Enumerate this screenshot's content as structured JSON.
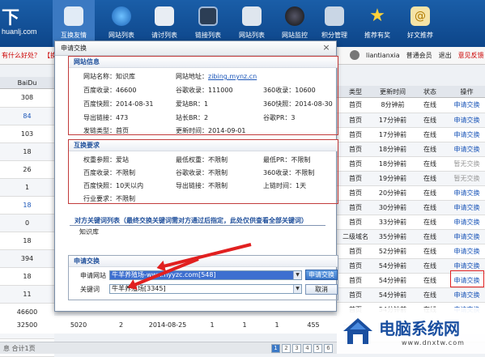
{
  "top": {
    "logo": "下",
    "logo_sub": "huanlj.com",
    "nav": [
      "互换友情",
      "网站列表",
      "请讨列表",
      "链接列表",
      "网站列表",
      "网站监控",
      "积分管理",
      "推荐有奖",
      "好文推荐"
    ]
  },
  "subbar": {
    "message": "有什么好处？",
    "swap_tag": "【换链",
    "username": "liantianxia",
    "level": "普通会员",
    "logout": "退出",
    "feedback": "意见反馈"
  },
  "left_table": {
    "header": "BaiDu",
    "values": [
      "308",
      "84",
      "103",
      "18",
      "26",
      "1",
      "18",
      "0",
      "18",
      "394",
      "18",
      "11",
      "46600",
      "1660",
      "18"
    ],
    "link_rows": [
      1,
      6
    ]
  },
  "right_table": {
    "headers": [
      "类型",
      "更新时间",
      "状态",
      "操作"
    ],
    "rows": [
      {
        "type": "首页",
        "time": "8分钟前",
        "status": "在线",
        "op": "申请交换"
      },
      {
        "type": "首页",
        "time": "17分钟前",
        "status": "在线",
        "op": "申请交换"
      },
      {
        "type": "首页",
        "time": "17分钟前",
        "status": "在线",
        "op": "申请交换"
      },
      {
        "type": "首页",
        "time": "18分钟前",
        "status": "在线",
        "op": "申请交换"
      },
      {
        "type": "首页",
        "time": "18分钟前",
        "status": "在线",
        "op": "暂无交换"
      },
      {
        "type": "首页",
        "time": "19分钟前",
        "status": "在线",
        "op": "暂无交换"
      },
      {
        "type": "首页",
        "time": "20分钟前",
        "status": "在线",
        "op": "申请交换"
      },
      {
        "type": "首页",
        "time": "30分钟前",
        "status": "在线",
        "op": "申请交换"
      },
      {
        "type": "首页",
        "time": "33分钟前",
        "status": "在线",
        "op": "申请交换"
      },
      {
        "type": "二级域名",
        "time": "35分钟前",
        "status": "在线",
        "op": "申请交换"
      },
      {
        "type": "首页",
        "time": "52分钟前",
        "status": "在线",
        "op": "申请交换"
      },
      {
        "type": "首页",
        "time": "54分钟前",
        "status": "在线",
        "op": "申请交换"
      },
      {
        "type": "首页",
        "time": "54分钟前",
        "status": "在线",
        "op": "申请交换"
      },
      {
        "type": "首页",
        "time": "54分钟前",
        "status": "在线",
        "op": "申请交换"
      },
      {
        "type": "首页",
        "time": "54分钟前",
        "status": "在线",
        "op": "申请交换"
      }
    ],
    "grey_rows": [
      4,
      5
    ]
  },
  "bottom_row": [
    "32500",
    "5020",
    "2",
    "2014-08-25",
    "1",
    "1",
    "1",
    "455",
    "--"
  ],
  "statusbar": {
    "text": "息 合计1页",
    "pages": [
      "1",
      "2",
      "3",
      "4",
      "5",
      "6"
    ]
  },
  "watermark": {
    "cn": "电脑系统网",
    "en": "www.dnxtw.com"
  },
  "dialog": {
    "title": "申请交换",
    "close": "×",
    "site_info": {
      "heading": "网站信息",
      "name": "网站名称：知识库",
      "url_label": "网站地址：",
      "url": "zibing.mynz.cn",
      "baidu_index": "百度收录：46600",
      "google_index": "谷歌收录：111000",
      "s360_index": "360收录：10600",
      "baidu_snap": "百度快照：2014-08-31",
      "aizhan": "爱站BR：1",
      "s360_snap": "360快照：2014-08-30",
      "export": "导出链接：473",
      "zhanzhang": "站长BR：2",
      "google_pr": "谷歌PR：3",
      "position": "发链类型：首页",
      "updated": "更新时间：2014-09-01"
    },
    "requirements": {
      "heading": "互换要求",
      "weight": "权重参照：爱站",
      "min_weight": "最低权重：不限制",
      "min_pr": "最低PR：不限制",
      "baidu_index": "百度收录：不限制",
      "google_index": "谷歌收录：不限制",
      "s360_index": "360收录：不限制",
      "baidu_snap": "百度快照：10天以内",
      "export": "导出链接：不限制",
      "online": "上链时间：1天",
      "industry": "行业要求：不限制"
    },
    "keywords": {
      "heading": "对方关键词列表（最终交换关键词需对方通过后指定，此处仅供查看全部关键词）",
      "value": "知识库"
    },
    "apply": {
      "heading": "申请交换",
      "site_label": "申请网站",
      "site_value": "牛羊养殖场-www.nyyzc.com[548]",
      "apply_btn": "申请交换",
      "kw_label": "关键词",
      "kw_value": "牛羊养殖场[3345]",
      "cancel_btn": "取消"
    }
  },
  "colors": {
    "brand": "#0d4589",
    "highlight_box": "#c23b3b",
    "annotation_arrow": "#e12020"
  }
}
